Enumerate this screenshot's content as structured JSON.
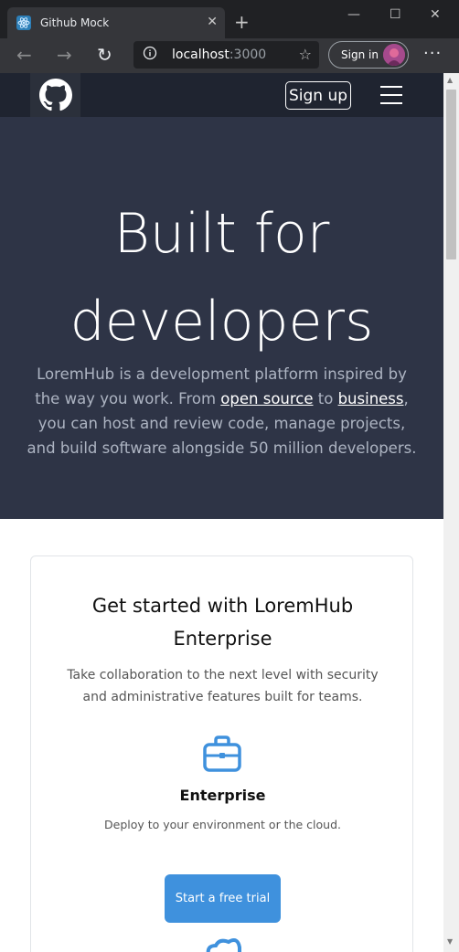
{
  "browser": {
    "tab_title": "Github Mock",
    "tab_close": "✕",
    "new_tab": "+",
    "address_host": "localhost",
    "address_port": ":3000",
    "signin_label": "Sign in",
    "menu": "···",
    "minimize": "—",
    "maximize": "☐",
    "close": "✕",
    "back": "←",
    "forward": "→",
    "reload": "↻",
    "favorite": "☆"
  },
  "header": {
    "signup_label": "Sign up"
  },
  "hero": {
    "title_line1": "Built for",
    "title_line2": "developers",
    "text_before": "LoremHub is a development platform inspired by the way you work. From ",
    "link1": "open source",
    "text_mid": " to ",
    "link2": "business",
    "text_after": ", you can host and review code, manage projects, and build software alongside 50 million developers."
  },
  "card": {
    "title": "Get started with LoremHub Enterprise",
    "description": "Take collaboration to the next level with security and administrative features built for teams.",
    "tier_name": "Enterprise",
    "tier_description": "Deploy to your environment or the cloud.",
    "cta_label": "Start a free trial"
  },
  "colors": {
    "accent": "#3f91dd",
    "header_bg": "#1f2430",
    "hero_bg": "#2e3446"
  }
}
